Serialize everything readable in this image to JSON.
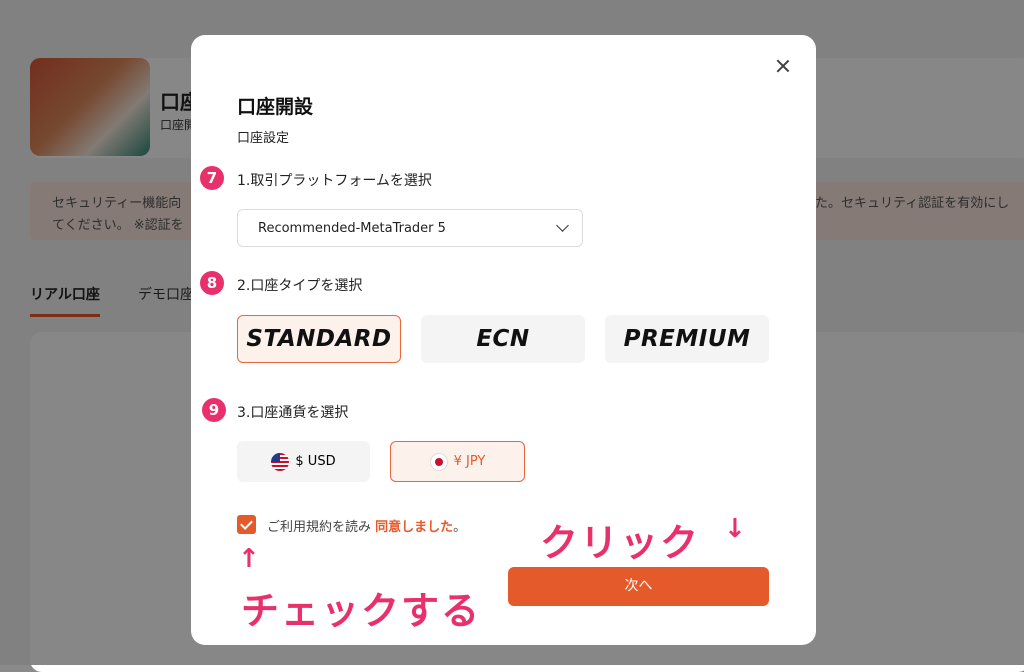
{
  "background": {
    "card_title": "口座",
    "card_sub": "口座開",
    "notice_line1": "セキュリティー機能向",
    "notice_line2": "てください。 ※認証を",
    "notice_line3": "た。セキュリティ認証を有効にし",
    "tab_real": "リアル口座",
    "tab_demo": "デモ口座"
  },
  "modal": {
    "title": "口座開設",
    "subtitle": "口座設定",
    "close_icon": "close-icon",
    "step1": {
      "badge": "7",
      "label": "1.取引プラットフォームを選択",
      "select_value": "Recommended-MetaTrader 5"
    },
    "step2": {
      "badge": "8",
      "label": "2.口座タイプを選択",
      "options": [
        "STANDARD",
        "ECN",
        "PREMIUM"
      ],
      "selected": "STANDARD"
    },
    "step3": {
      "badge": "9",
      "label": "3.口座通貨を選択",
      "options": [
        "$ USD",
        "¥ JPY"
      ],
      "selected": "¥ JPY"
    },
    "agree_text": "ご利用規約を読み",
    "agree_link": "同意しました",
    "agree_suffix": "。",
    "next_label": "次へ"
  },
  "annotations": {
    "click": "クリック",
    "check": "チェックする"
  },
  "colors": {
    "accent": "#e55a2b",
    "annotation": "#e8316b"
  }
}
